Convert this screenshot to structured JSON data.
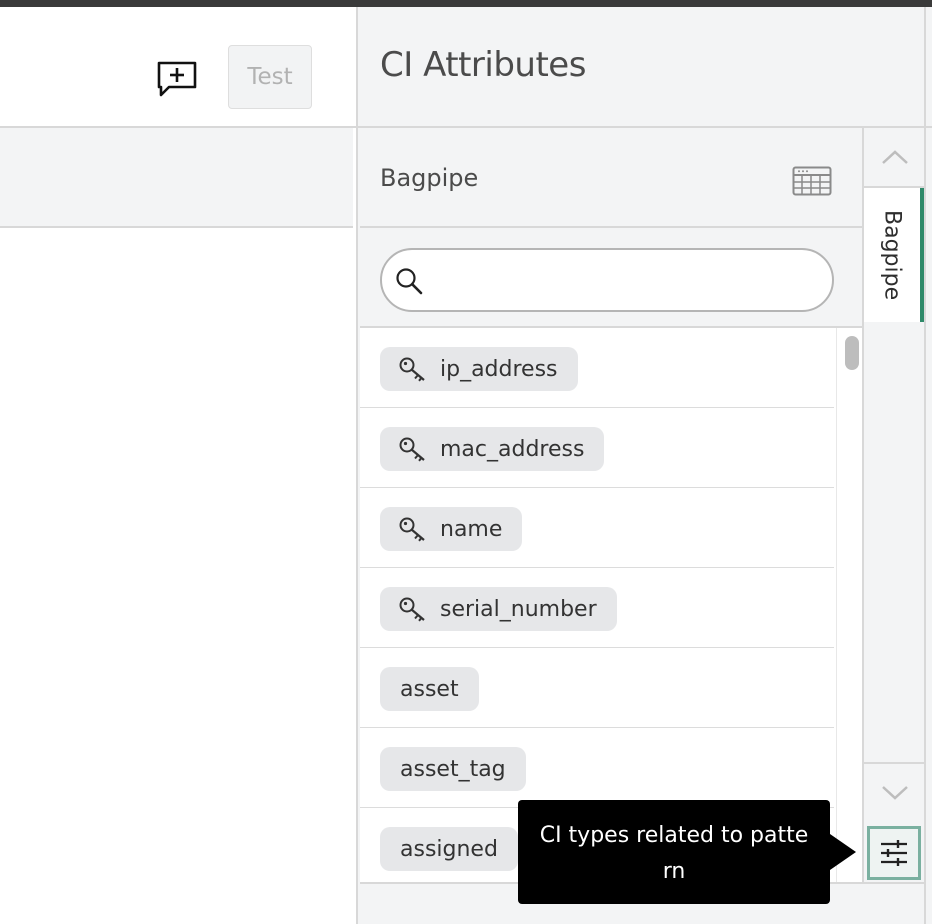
{
  "header": {
    "test_label": "Test"
  },
  "panel": {
    "title": "CI Attributes",
    "section_title": "Bagpipe",
    "search_placeholder": ""
  },
  "attributes": [
    {
      "label": "ip_address",
      "is_key": true
    },
    {
      "label": "mac_address",
      "is_key": true
    },
    {
      "label": "name",
      "is_key": true
    },
    {
      "label": "serial_number",
      "is_key": true
    },
    {
      "label": "asset",
      "is_key": false
    },
    {
      "label": "asset_tag",
      "is_key": false
    },
    {
      "label": "assigned",
      "is_key": false
    }
  ],
  "rail": {
    "tab_label": "Bagpipe"
  },
  "tooltip": {
    "text": "CI types related to pattern"
  },
  "icons": {
    "comment": "add-comment-icon",
    "table": "table-icon",
    "search": "search-icon",
    "key": "key-icon",
    "up": "chevron-up-icon",
    "down": "chevron-down-icon",
    "filter": "sliders-icon"
  },
  "colors": {
    "accent": "#2f8a6a",
    "panel_bg": "#f3f4f5",
    "chip_bg": "#e6e7e9",
    "tooltip_bg": "#000000"
  }
}
